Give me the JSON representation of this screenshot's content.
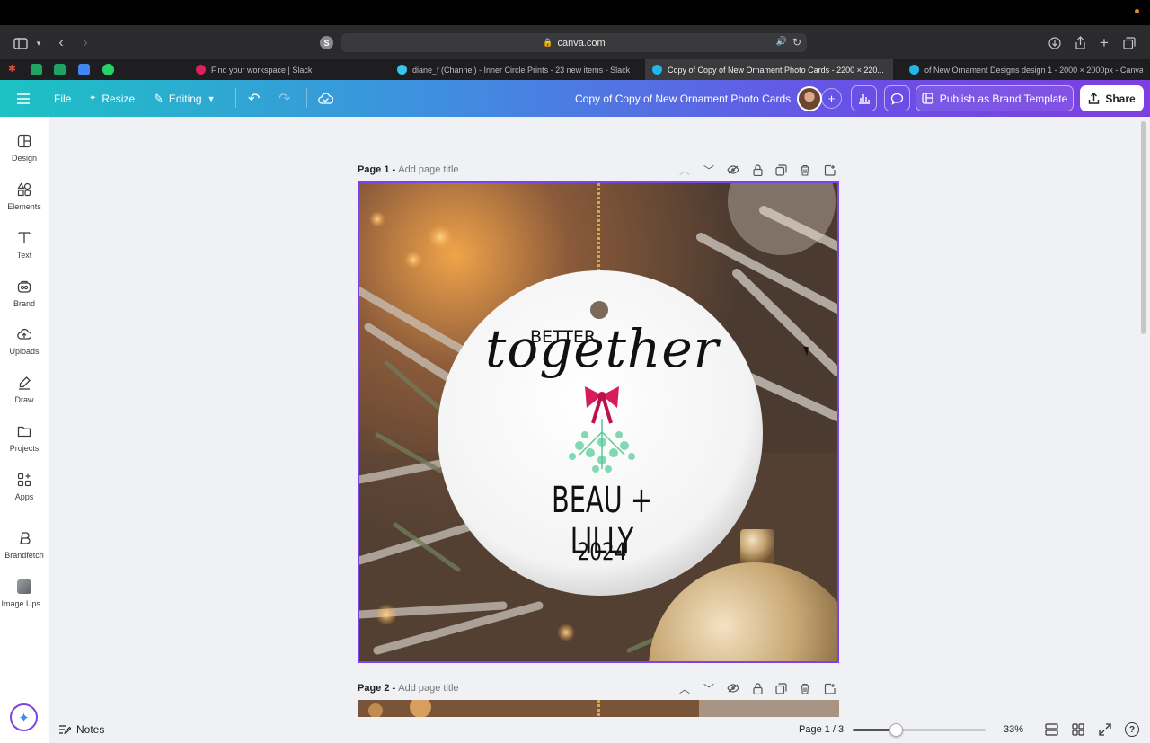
{
  "browser": {
    "url": "canva.com",
    "profile_initial": "S",
    "tabs": [
      {
        "label": "Find your workspace | Slack",
        "fav_color": "#e01e5a",
        "active": false
      },
      {
        "label": "diane_f (Channel) - Inner Circle Prints - 23 new items - Slack",
        "fav_color": "#36c5f0",
        "active": false
      },
      {
        "label": "Copy of Copy of New Ornament Photo Cards - 2200 × 220...",
        "fav_color": "#1fb6e8",
        "active": true
      },
      {
        "label": "of New Ornament Designs design 1 - 2000 × 2000px - Canva",
        "fav_color": "#1fb6e8",
        "active": false
      }
    ]
  },
  "header": {
    "file_label": "File",
    "resize_label": "Resize",
    "editing_label": "Editing",
    "doc_title": "Copy of Copy of New Ornament Photo Cards",
    "publish_label": "Publish as Brand Template",
    "share_label": "Share",
    "colors": {
      "gradient_start": "#1cc2c4",
      "gradient_end": "#7d3fe0",
      "selection": "#7b44e8"
    }
  },
  "sidebar": {
    "items": [
      {
        "label": "Design",
        "icon": "design-icon"
      },
      {
        "label": "Elements",
        "icon": "elements-icon"
      },
      {
        "label": "Text",
        "icon": "text-icon"
      },
      {
        "label": "Brand",
        "icon": "brand-icon"
      },
      {
        "label": "Uploads",
        "icon": "uploads-icon"
      },
      {
        "label": "Draw",
        "icon": "draw-icon"
      },
      {
        "label": "Projects",
        "icon": "projects-icon"
      },
      {
        "label": "Apps",
        "icon": "apps-icon"
      },
      {
        "label": "Brandfetch",
        "icon": "brandfetch-icon"
      },
      {
        "label": "Image Ups...",
        "icon": "image-upscaler-icon"
      }
    ]
  },
  "pages": {
    "page1_label": "Page 1 -",
    "page1_title_placeholder": "Add page title",
    "page2_label": "Page 2 -",
    "page2_title_placeholder": "Add page title"
  },
  "design": {
    "line1": "BETTER",
    "line2": "together",
    "names": "BEAU + LILLY",
    "year": "2024"
  },
  "footer": {
    "notes_label": "Notes",
    "page_indicator": "Page 1 / 3",
    "zoom": "33%",
    "zoom_value_percent": 33
  }
}
